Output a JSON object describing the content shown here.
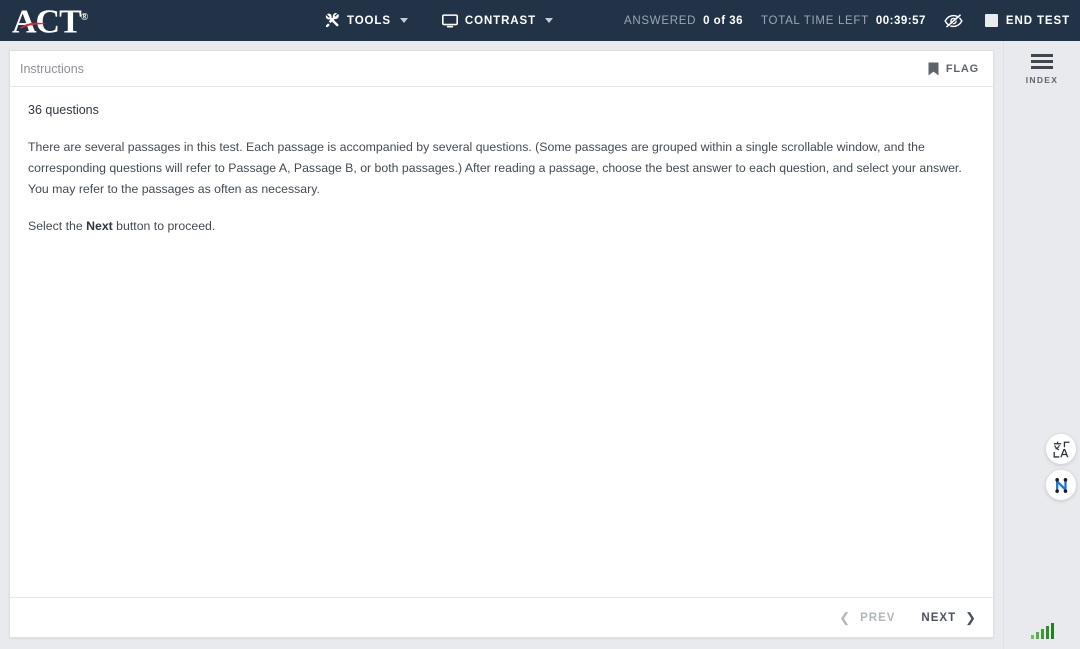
{
  "header": {
    "logo_text": "ACT",
    "logo_registered": "®",
    "logo_icon": "act-logo",
    "tools_label": "TOOLS",
    "tools_icon": "tools-icon",
    "contrast_label": "CONTRAST",
    "contrast_icon": "monitor-icon",
    "answered_label": "ANSWERED",
    "answered_value": "0 of 36",
    "time_label": "TOTAL TIME LEFT",
    "time_value": "00:39:57",
    "hide_timer_icon": "eye-slash-icon",
    "end_test_label": "END TEST",
    "end_test_icon": "stop-square-icon",
    "background_color": "#223348"
  },
  "card": {
    "title": "Instructions",
    "flag_label": "FLAG",
    "flag_icon": "bookmark-icon",
    "question_count": "36 questions",
    "paragraph_1": "There are several passages in this test. Each passage is accompanied by several questions. (Some passages are grouped within a single scrollable window, and the corresponding questions will refer to Passage A, Passage B, or both passages.) After reading a passage, choose the best answer to each question, and select your answer. You may refer to the passages as often as necessary.",
    "paragraph_2_prefix": "Select the ",
    "paragraph_2_bold": "Next",
    "paragraph_2_suffix": " button to proceed."
  },
  "footer": {
    "prev_label": "PREV",
    "prev_icon": "chevron-left-icon",
    "next_label": "NEXT",
    "next_icon": "chevron-right-icon"
  },
  "sidebar": {
    "index_label": "INDEX",
    "index_icon": "hamburger-menu-icon",
    "translate_icon": "translate-icon",
    "network_icon": "network-nodes-icon",
    "signal_icon": "signal-strength-icon",
    "accent_blue": "#1a73e8",
    "signal_green": "#3f9a36"
  }
}
